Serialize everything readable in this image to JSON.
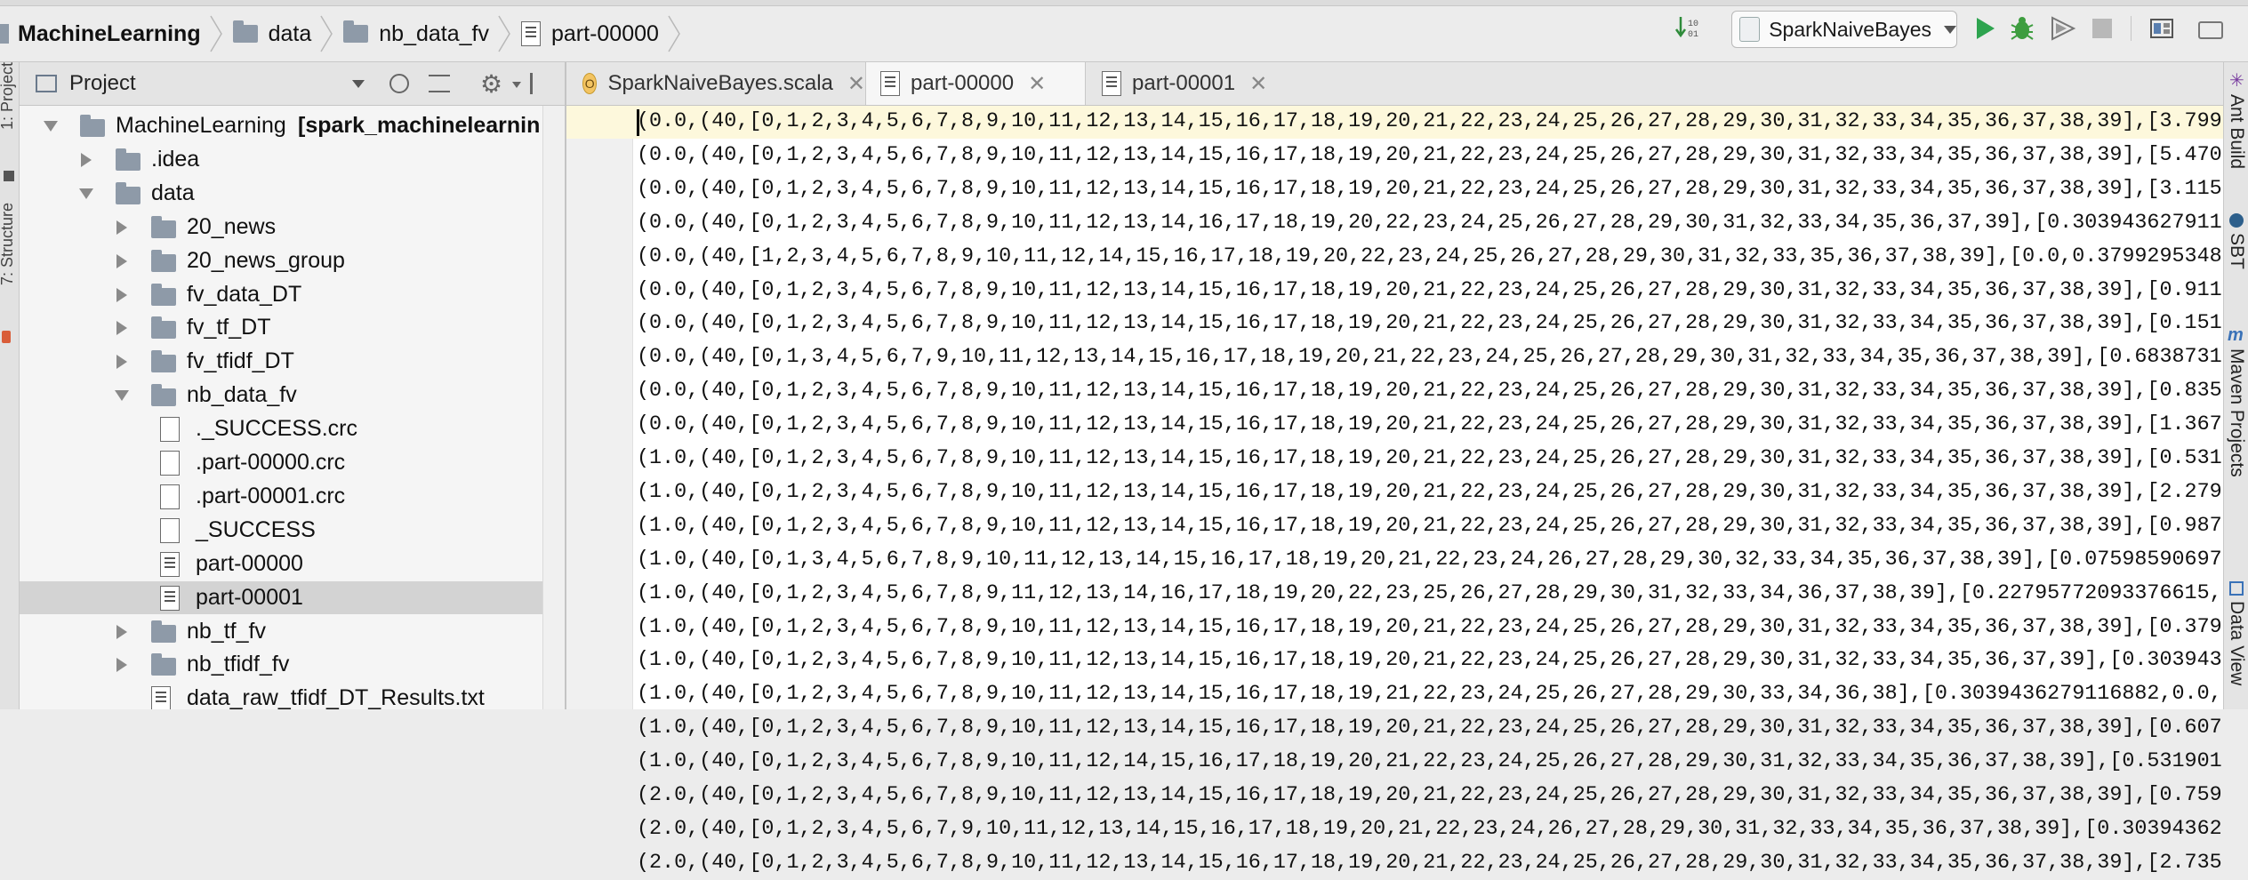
{
  "breadcrumb": [
    {
      "label": "MachineLearning",
      "icon": "module-folder-icon",
      "bold": true
    },
    {
      "label": "data",
      "icon": "folder-icon"
    },
    {
      "label": "nb_data_fv",
      "icon": "folder-icon"
    },
    {
      "label": "part-00000",
      "icon": "file-icon"
    }
  ],
  "toolbar": {
    "run_config": "SparkNaiveBayes",
    "icons": [
      "build-icon",
      "run-icon",
      "debug-icon",
      "coverage-icon",
      "stop-icon",
      "project-structure-icon"
    ],
    "colors": {
      "run": "#2ea44f",
      "debug": "#3d9d3f",
      "stop": "#b0b0b0"
    }
  },
  "left_strip": {
    "labels": [
      "1: Project",
      "7: Structure"
    ]
  },
  "project_panel": {
    "title": "Project",
    "icons": [
      "project-view-icon",
      "dropdown-icon",
      "scroll-from-source-icon",
      "collapse-all-icon",
      "settings-icon",
      "hide-panel-icon"
    ]
  },
  "tree": [
    {
      "label": "MachineLearning",
      "suffix": "[spark_machinelearnin",
      "depth": 0,
      "arrow": "down",
      "icon": "module-folder-icon"
    },
    {
      "label": ".idea",
      "depth": 1,
      "arrow": "right",
      "icon": "folder-icon"
    },
    {
      "label": "data",
      "depth": 1,
      "arrow": "down",
      "icon": "folder-icon"
    },
    {
      "label": "20_news",
      "depth": 2,
      "arrow": "right",
      "icon": "folder-icon"
    },
    {
      "label": "20_news_group",
      "depth": 2,
      "arrow": "right",
      "icon": "folder-icon"
    },
    {
      "label": "fv_data_DT",
      "depth": 2,
      "arrow": "right",
      "icon": "folder-icon"
    },
    {
      "label": "fv_tf_DT",
      "depth": 2,
      "arrow": "right",
      "icon": "folder-icon"
    },
    {
      "label": "fv_tfidf_DT",
      "depth": 2,
      "arrow": "right",
      "icon": "folder-icon"
    },
    {
      "label": "nb_data_fv",
      "depth": 2,
      "arrow": "down",
      "icon": "folder-icon"
    },
    {
      "label": "._SUCCESS.crc",
      "depth": 3,
      "arrow": "none",
      "icon": "file-icon"
    },
    {
      "label": ".part-00000.crc",
      "depth": 3,
      "arrow": "none",
      "icon": "file-icon"
    },
    {
      "label": ".part-00001.crc",
      "depth": 3,
      "arrow": "none",
      "icon": "file-icon"
    },
    {
      "label": "_SUCCESS",
      "depth": 3,
      "arrow": "none",
      "icon": "file-icon"
    },
    {
      "label": "part-00000",
      "depth": 3,
      "arrow": "none",
      "icon": "text-file-icon"
    },
    {
      "label": "part-00001",
      "depth": 3,
      "arrow": "none",
      "icon": "text-file-icon",
      "selected": true
    },
    {
      "label": "nb_tf_fv",
      "depth": 2,
      "arrow": "right",
      "icon": "folder-icon"
    },
    {
      "label": "nb_tfidf_fv",
      "depth": 2,
      "arrow": "right",
      "icon": "folder-icon"
    },
    {
      "label": "data_raw_tfidf_DT_Results.txt",
      "depth": 2,
      "arrow": "none",
      "icon": "text-file-icon"
    }
  ],
  "tabs": [
    {
      "label": "SparkNaiveBayes.scala",
      "icon": "scala-class-icon",
      "closable": true,
      "active": false
    },
    {
      "label": "part-00000",
      "icon": "text-file-icon",
      "closable": true,
      "active": true
    },
    {
      "label": "part-00001",
      "icon": "text-file-icon",
      "closable": true,
      "active": false
    }
  ],
  "editor_lines": [
    "(0.0,(40,[0,1,2,3,4,5,6,7,8,9,10,11,12,13,14,15,16,17,18,19,20,21,22,23,24,25,26,27,28,29,30,31,32,33,34,35,36,37,38,39],[3.799",
    "(0.0,(40,[0,1,2,3,4,5,6,7,8,9,10,11,12,13,14,15,16,17,18,19,20,21,22,23,24,25,26,27,28,29,30,31,32,33,34,35,36,37,38,39],[5.470",
    "(0.0,(40,[0,1,2,3,4,5,6,7,8,9,10,11,12,13,14,15,16,17,18,19,20,21,22,23,24,25,26,27,28,29,30,31,32,33,34,35,36,37,38,39],[3.115",
    "(0.0,(40,[0,1,2,3,4,5,6,7,8,9,10,11,12,13,14,16,17,18,19,20,22,23,24,25,26,27,28,29,30,31,32,33,34,35,36,37,39],[0.303943627911",
    "(0.0,(40,[1,2,3,4,5,6,7,8,9,10,11,12,14,15,16,17,18,19,20,22,23,24,25,26,27,28,29,30,31,32,33,35,36,37,38,39],[0.0,0.3799295348",
    "(0.0,(40,[0,1,2,3,4,5,6,7,8,9,10,11,12,13,14,15,16,17,18,19,20,21,22,23,24,25,26,27,28,29,30,31,32,33,34,35,36,37,38,39],[0.911",
    "(0.0,(40,[0,1,2,3,4,5,6,7,8,9,10,11,12,13,14,15,16,17,18,19,20,21,22,23,24,25,26,27,28,29,30,31,32,33,34,35,36,37,38,39],[0.151",
    "(0.0,(40,[0,1,3,4,5,6,7,9,10,11,12,13,14,15,16,17,18,19,20,21,22,23,24,25,26,27,28,29,30,31,32,33,34,35,36,37,38,39],[0.6838731",
    "(0.0,(40,[0,1,2,3,4,5,6,7,8,9,10,11,12,13,14,15,16,17,18,19,20,21,22,23,24,25,26,27,28,29,30,31,32,33,34,35,36,37,38,39],[0.835",
    "(0.0,(40,[0,1,2,3,4,5,6,7,8,9,10,11,12,13,14,15,16,17,18,19,20,21,22,23,24,25,26,27,28,29,30,31,32,33,34,35,36,37,38,39],[1.367",
    "(1.0,(40,[0,1,2,3,4,5,6,7,8,9,10,11,12,13,14,15,16,17,18,19,20,21,22,23,24,25,26,27,28,29,30,31,32,33,34,35,36,37,38,39],[0.531",
    "(1.0,(40,[0,1,2,3,4,5,6,7,8,9,10,11,12,13,14,15,16,17,18,19,20,21,22,23,24,25,26,27,28,29,30,31,32,33,34,35,36,37,38,39],[2.279",
    "(1.0,(40,[0,1,2,3,4,5,6,7,8,9,10,11,12,13,14,15,16,17,18,19,20,21,22,23,24,25,26,27,28,29,30,31,32,33,34,35,36,37,38,39],[0.987",
    "(1.0,(40,[0,1,3,4,5,6,7,8,9,10,11,12,13,14,15,16,17,18,19,20,21,22,23,24,26,27,28,29,30,32,33,34,35,36,37,38,39],[0.07598590697",
    "(1.0,(40,[0,1,2,3,4,5,6,7,8,9,11,12,13,14,16,17,18,19,20,22,23,25,26,27,28,29,30,31,32,33,34,36,37,38,39],[0.22795772093376615,",
    "(1.0,(40,[0,1,2,3,4,5,6,7,8,9,10,11,12,13,14,15,16,17,18,19,20,21,22,23,24,25,26,27,28,29,30,31,32,33,34,35,36,37,38,39],[0.379",
    "(1.0,(40,[0,1,2,3,4,5,6,7,8,9,10,11,12,13,14,15,16,17,18,19,20,21,22,23,24,25,26,27,28,29,30,31,32,33,34,35,36,37,39],[0.303943",
    "(1.0,(40,[0,1,2,3,4,5,6,7,8,9,10,11,12,13,14,15,16,17,18,19,21,22,23,24,25,26,27,28,29,30,33,34,36,38],[0.3039436279116882,0.0,",
    "(1.0,(40,[0,1,2,3,4,5,6,7,8,9,10,11,12,13,14,15,16,17,18,19,20,21,22,23,24,25,26,27,28,29,30,31,32,33,34,35,36,37,38,39],[0.607",
    "(1.0,(40,[0,1,2,3,4,5,6,7,8,9,10,11,12,14,15,16,17,18,19,20,21,22,23,24,25,26,27,28,29,30,31,32,33,34,35,36,37,38,39],[0.531901",
    "(2.0,(40,[0,1,2,3,4,5,6,7,8,9,10,11,12,13,14,15,16,17,18,19,20,21,22,23,24,25,26,27,28,29,30,31,32,33,34,35,36,37,38,39],[0.759",
    "(2.0,(40,[0,1,2,3,4,5,6,7,9,10,11,12,13,14,15,16,17,18,19,20,21,22,23,24,26,27,28,29,30,31,32,33,34,35,36,37,38,39],[0.30394362",
    "(2.0,(40,[0,1,2,3,4,5,6,7,8,9,10,11,12,13,14,15,16,17,18,19,20,21,22,23,24,25,26,27,28,29,30,31,32,33,34,35,36,37,38,39],[2.735"
  ],
  "right_strip": {
    "labels": [
      "Ant Build",
      "SBT",
      "Maven Projects",
      "Data View"
    ]
  }
}
